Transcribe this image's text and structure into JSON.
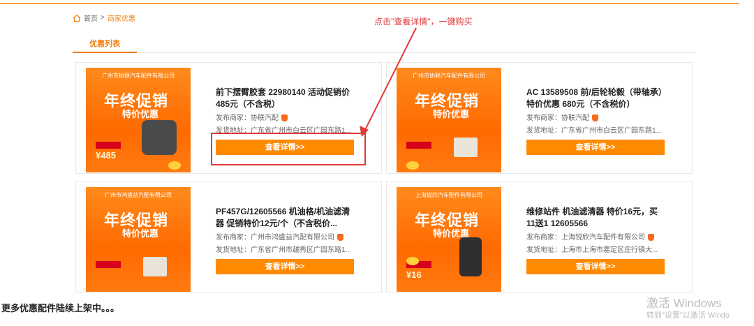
{
  "breadcrumb": {
    "home": "首页",
    "separator": ">",
    "current": "商家优惠"
  },
  "annotation": "点击\"查看详情\"，一键购买",
  "tabs": [
    {
      "label": "优惠列表"
    }
  ],
  "cards": [
    {
      "thumb_company": "广州市协联汽车配件有限公司",
      "thumb_promo_1": "年终促销",
      "thumb_promo_2": "特价优惠",
      "thumb_price": "¥485",
      "title": "前下摆臂胶套 22980140 活动促销价485元（不含税）",
      "seller": "发布商家：协联汽配",
      "address": "发货地址：广东省广州市白云区广园东路1...",
      "button": "查看详情>>"
    },
    {
      "thumb_company": "广州市协联汽车配件有限公司",
      "thumb_promo_1": "年终促销",
      "thumb_promo_2": "特价优惠",
      "thumb_price": "",
      "title": "AC 13589508 前/后轮轮毂（带轴承）特价优惠 680元（不含税价）",
      "seller": "发布商家：协联汽配",
      "address": "发货地址：广东省广州市白云区广园东路1...",
      "button": "查看详情>>"
    },
    {
      "thumb_company": "广州市鸿盛益汽配有限公司",
      "thumb_promo_1": "年终促销",
      "thumb_promo_2": "特价优惠",
      "thumb_price": "",
      "title": "PF457G/12605566 机油格/机油滤清器 促销特价12元/个（不含税价...",
      "seller": "发布商家：广州市鸿盛益汽配有限公司",
      "address": "发货地址：广东省广州市越秀区广园东路1...",
      "button": "查看详情>>"
    },
    {
      "thumb_company": "上海锐欣汽车配件有限公司",
      "thumb_promo_1": "年终促销",
      "thumb_promo_2": "特价优惠",
      "thumb_price": "¥16",
      "title": "维修站件 机油滤清器 特价16元，买11送1 12605566",
      "seller": "发布商家：上海锐欣汽车配件有限公司",
      "address": "发货地址：上海市上海市嘉定区庄行镇大...",
      "button": "查看详情>>"
    }
  ],
  "footer": "更多优惠配件陆续上架中。。。",
  "watermark": {
    "line1": "激活 Windows",
    "line2": "转到\"设置\"以激活 Windo"
  },
  "colors": {
    "accent": "#ff8a00",
    "annotation": "#e03a3a",
    "thumb_bg": "#ff6a00"
  }
}
